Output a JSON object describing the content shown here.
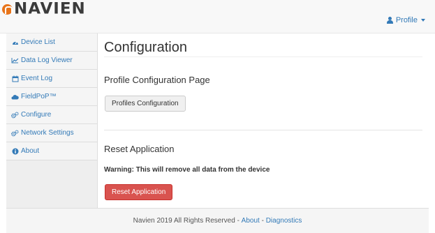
{
  "brand": {
    "name": "NAVIEN",
    "accent": "#e8741a"
  },
  "header": {
    "profile_label": "Profile",
    "profile_icon": "user-icon"
  },
  "sidebar": {
    "items": [
      {
        "label": "Device List",
        "icon": "dashboard-icon"
      },
      {
        "label": "Data Log Viewer",
        "icon": "line-chart-icon"
      },
      {
        "label": "Event Log",
        "icon": "calendar-icon"
      },
      {
        "label": "FieldPoP™",
        "icon": "cloud-icon"
      },
      {
        "label": "Configure",
        "icon": "cogs-icon"
      },
      {
        "label": "Network Settings",
        "icon": "cogs-icon"
      },
      {
        "label": "About",
        "icon": "info-icon"
      }
    ]
  },
  "main": {
    "title": "Configuration",
    "profile_section": {
      "title": "Profile Configuration Page",
      "button": "Profiles Configuration"
    },
    "reset_section": {
      "title": "Reset Application",
      "warning": "Warning: This will remove all data from the device",
      "button": "Reset Application"
    }
  },
  "footer": {
    "text": "Navien 2019 All Rights Reserved - ",
    "about_link": "About",
    "separator": " - ",
    "diagnostics_link": "Diagnostics"
  },
  "colors": {
    "link": "#337ab7",
    "danger": "#d9534f"
  }
}
